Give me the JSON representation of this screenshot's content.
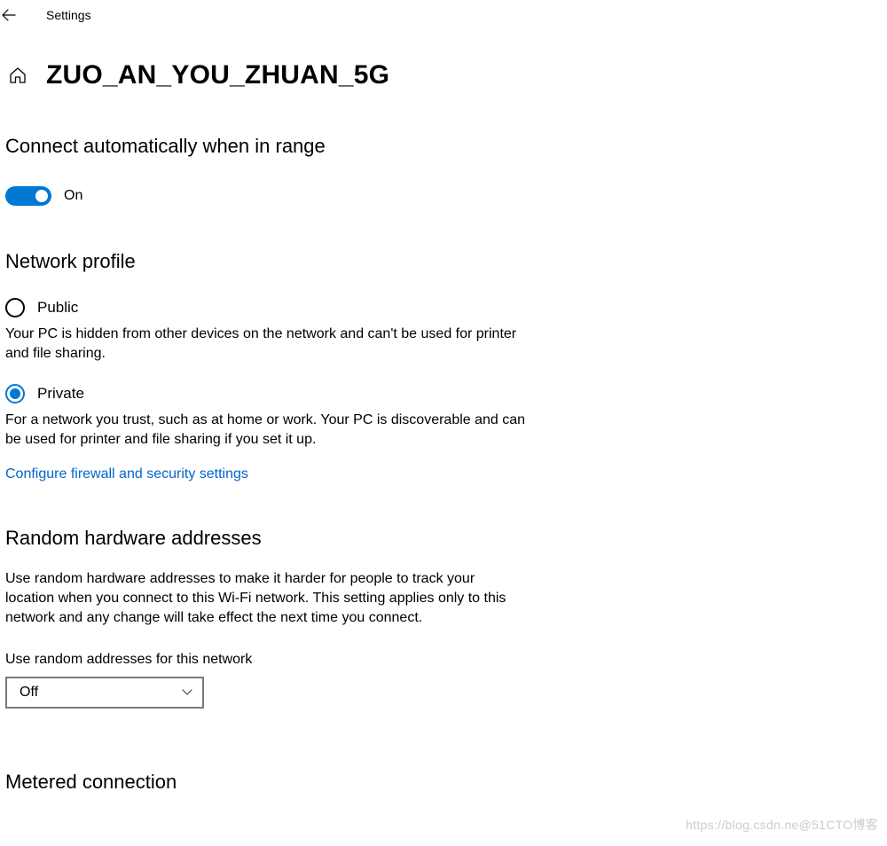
{
  "topbar": {
    "title": "Settings"
  },
  "header": {
    "title": "ZUO_AN_YOU_ZHUAN_5G"
  },
  "autoconnect": {
    "heading": "Connect automatically when in range",
    "state_label": "On"
  },
  "network_profile": {
    "heading": "Network profile",
    "public": {
      "label": "Public",
      "desc": "Your PC is hidden from other devices on the network and can't be used for printer and file sharing."
    },
    "private": {
      "label": "Private",
      "desc": "For a network you trust, such as at home or work. Your PC is discoverable and can be used for printer and file sharing if you set it up."
    },
    "link": "Configure firewall and security settings"
  },
  "random_hw": {
    "heading": "Random hardware addresses",
    "desc": "Use random hardware addresses to make it harder for people to track your location when you connect to this Wi-Fi network. This setting applies only to this network and any change will take effect the next time you connect.",
    "field_label": "Use random addresses for this network",
    "value": "Off"
  },
  "metered": {
    "heading": "Metered connection"
  },
  "watermark": "https://blog.csdn.ne@51CTO博客"
}
